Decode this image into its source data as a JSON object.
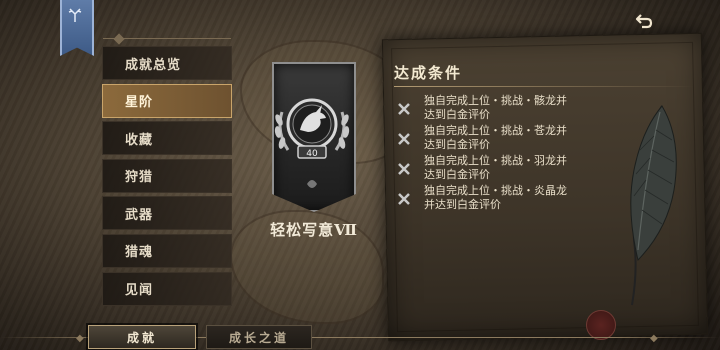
{
  "menu": {
    "items": [
      {
        "label": "成就总览",
        "active": false
      },
      {
        "label": "星阶",
        "active": true
      },
      {
        "label": "收藏",
        "active": false
      },
      {
        "label": "狩猎",
        "active": false
      },
      {
        "label": "武器",
        "active": false
      },
      {
        "label": "猎魂",
        "active": false
      },
      {
        "label": "见闻",
        "active": false
      }
    ]
  },
  "achievement": {
    "title": "轻松写意Ⅶ",
    "level": "40",
    "emblem_icon": "dragon-crest-icon",
    "emblem_color": "#9a9a9a"
  },
  "conditions": {
    "header": "达成条件",
    "items": [
      {
        "line1": "独自完成上位・挑战・骸龙并",
        "line2": "达到白金评价",
        "status": "incomplete"
      },
      {
        "line1": "独自完成上位・挑战・苍龙并",
        "line2": "达到白金评价",
        "status": "incomplete"
      },
      {
        "line1": "独自完成上位・挑战・羽龙并",
        "line2": "达到白金评价",
        "status": "incomplete"
      },
      {
        "line1": "独自完成上位・挑战・炎晶龙",
        "line2": "并达到白金评价",
        "status": "incomplete"
      }
    ]
  },
  "tabs": {
    "achievements": "成就",
    "growth": "成长之道"
  },
  "icons": {
    "back": "back-arrow-icon",
    "banner": "antler-crest-icon",
    "incomplete": "x-mark-icon",
    "decoration": "feather-quill-icon"
  },
  "colors": {
    "accent_active": "#8c6a3c",
    "text_light": "#e6dcc8",
    "banner_blue": "#4d6a96"
  }
}
